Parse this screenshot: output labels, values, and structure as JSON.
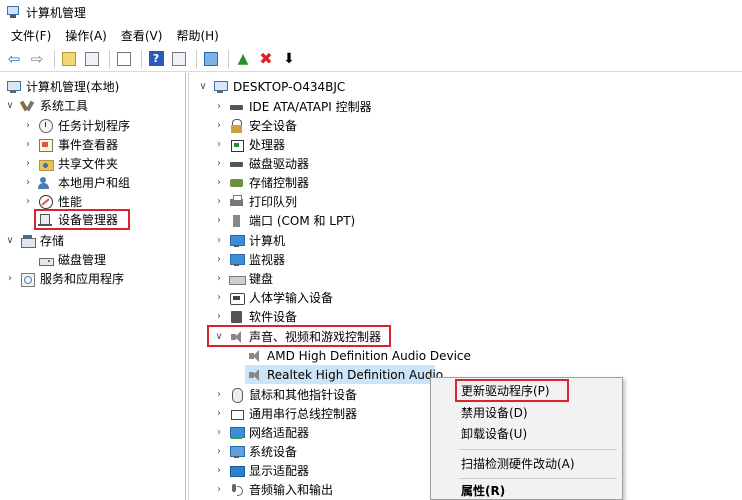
{
  "window": {
    "title": "计算机管理"
  },
  "menu": [
    "文件(F)",
    "操作(A)",
    "查看(V)",
    "帮助(H)"
  ],
  "left_tree": {
    "root": "计算机管理(本地)",
    "system_tools": "系统工具",
    "task_scheduler": "任务计划程序",
    "event_viewer": "事件查看器",
    "shared_folders": "共享文件夹",
    "local_users": "本地用户和组",
    "performance": "性能",
    "device_manager": "设备管理器",
    "storage": "存储",
    "disk_management": "磁盘管理",
    "services_apps": "服务和应用程序"
  },
  "device_tree": {
    "computer_name": "DESKTOP-O434BJC",
    "categories": [
      "IDE ATA/ATAPI 控制器",
      "安全设备",
      "处理器",
      "磁盘驱动器",
      "存储控制器",
      "打印队列",
      "端口 (COM 和 LPT)",
      "计算机",
      "监视器",
      "键盘",
      "人体学输入设备",
      "软件设备",
      "声音、视频和游戏控制器",
      "鼠标和其他指针设备",
      "通用串行总线控制器",
      "网络适配器",
      "系统设备",
      "显示适配器",
      "音频输入和输出"
    ],
    "audio_children": [
      "AMD High Definition Audio Device",
      "Realtek High Definition Audio"
    ]
  },
  "context_menu": {
    "update_driver": "更新驱动程序(P)",
    "disable_device": "禁用设备(D)",
    "uninstall_device": "卸载设备(U)",
    "scan_hardware": "扫描检测硬件改动(A)",
    "properties": "属性(R)"
  }
}
